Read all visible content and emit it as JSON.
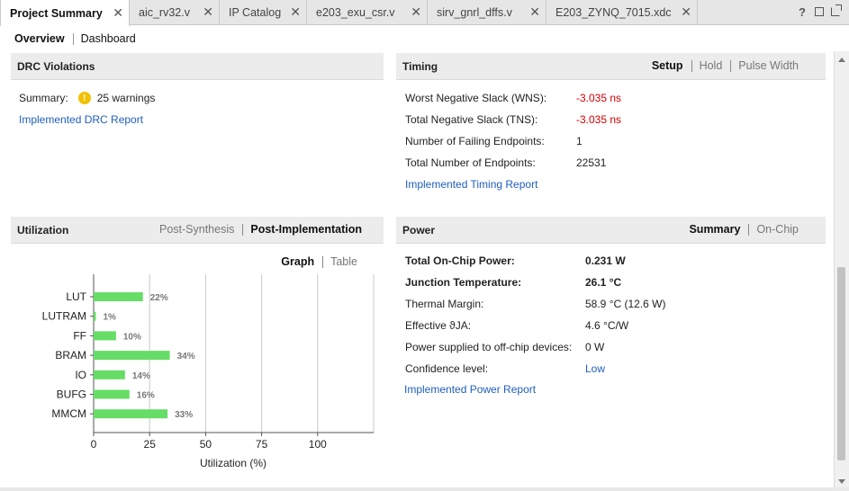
{
  "tabs": [
    {
      "label": "Project Summary",
      "active": true
    },
    {
      "label": "aic_rv32.v",
      "active": false
    },
    {
      "label": "IP Catalog",
      "active": false
    },
    {
      "label": "e203_exu_csr.v",
      "active": false
    },
    {
      "label": "sirv_gnrl_dffs.v",
      "active": false
    },
    {
      "label": "E203_ZYNQ_7015.xdc",
      "active": false
    }
  ],
  "tab_tools": {
    "help": "?"
  },
  "subtabs": {
    "overview": "Overview",
    "dashboard": "Dashboard"
  },
  "drc": {
    "title": "DRC Violations",
    "summary_label": "Summary:",
    "summary_value": "25 warnings",
    "report_link": "Implemented DRC Report"
  },
  "timing": {
    "title": "Timing",
    "views": {
      "setup": "Setup",
      "hold": "Hold",
      "pulse_width": "Pulse Width"
    },
    "rows": [
      {
        "label": "Worst Negative Slack (WNS):",
        "value": "-3.035 ns"
      },
      {
        "label": "Total Negative Slack (TNS):",
        "value": "-3.035 ns"
      },
      {
        "label": "Number of Failing Endpoints:",
        "value": "1"
      },
      {
        "label": "Total Number of Endpoints:",
        "value": "22531"
      }
    ],
    "report_link": "Implemented Timing Report"
  },
  "utilization": {
    "title": "Utilization",
    "views": {
      "post_synthesis": "Post-Synthesis",
      "post_implementation": "Post-Implementation"
    },
    "display": {
      "graph": "Graph",
      "table": "Table"
    }
  },
  "power": {
    "title": "Power",
    "views": {
      "summary": "Summary",
      "on_chip": "On-Chip"
    },
    "rows": [
      {
        "label": "Total On-Chip Power:",
        "value": "0.231 W"
      },
      {
        "label": "Junction Temperature:",
        "value": "26.1 °C"
      },
      {
        "label": "Thermal Margin:",
        "value": "58.9 °C (12.6 W)"
      },
      {
        "label": "Effective ϑJA:",
        "value": "4.6 °C/W"
      },
      {
        "label": "Power supplied to off-chip devices:",
        "value": "0 W"
      },
      {
        "label": "Confidence level:",
        "value": "Low"
      }
    ],
    "report_link": "Implemented Power Report"
  },
  "colors": {
    "link": "#1f5fbf",
    "negative": "#d40000",
    "bar": "#66dd66",
    "warning": "#f2c100"
  },
  "chart_data": {
    "type": "bar",
    "orientation": "horizontal",
    "categories": [
      "LUT",
      "LUTRAM",
      "FF",
      "BRAM",
      "IO",
      "BUFG",
      "MMCM"
    ],
    "values": [
      22,
      1,
      10,
      34,
      14,
      16,
      33
    ],
    "data_labels": [
      "22%",
      "1%",
      "10%",
      "34%",
      "14%",
      "16%",
      "33%"
    ],
    "xlabel": "Utilization (%)",
    "xlim": [
      0,
      125
    ],
    "xticks": [
      "0",
      "25",
      "50",
      "75",
      "100"
    ],
    "grid": "vertical"
  }
}
